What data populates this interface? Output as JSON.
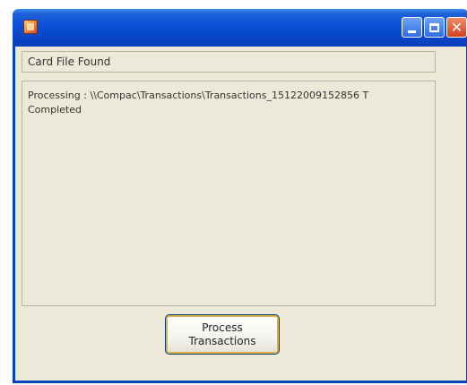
{
  "window": {
    "title": "",
    "controls": {
      "minimize_icon": "minimize-icon",
      "maximize_icon": "maximize-icon",
      "close_icon": "close-icon"
    }
  },
  "status": {
    "value": "Card File Found"
  },
  "log": {
    "lines": [
      "Processing : \\\\Compac\\Transactions\\Transactions_15122009152856 T",
      "Completed"
    ]
  },
  "actions": {
    "process_button_line1": "Process",
    "process_button_line2": "Transactions"
  },
  "colors": {
    "titlebar": "#0a4fd6",
    "window_bg": "#ece9d8",
    "close_button": "#d2431a"
  }
}
